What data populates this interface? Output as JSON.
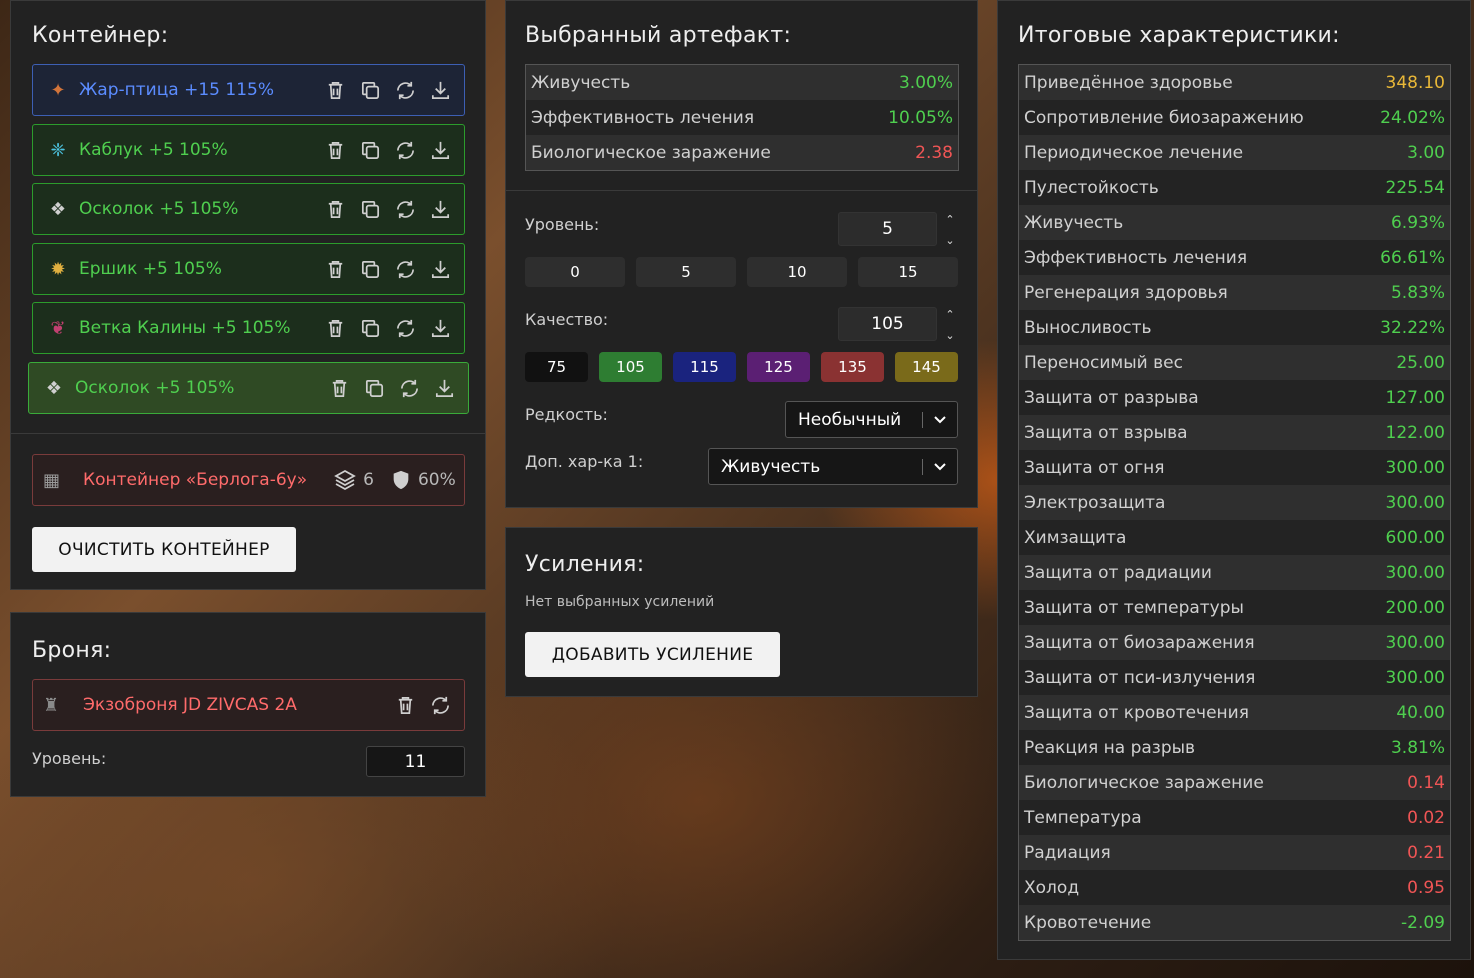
{
  "container": {
    "title": "Контейнер:",
    "items": [
      {
        "label": "Жар-птица +15 115%"
      },
      {
        "label": "Каблук +5 105%"
      },
      {
        "label": "Осколок +5 105%"
      },
      {
        "label": "Ершик +5 105%"
      },
      {
        "label": "Ветка Калины +5 105%"
      },
      {
        "label": "Осколок +5 105%"
      }
    ],
    "box": {
      "label": "Контейнер «Берлога-6у»",
      "slots": "6",
      "protection": "60%"
    },
    "clear_button": "ОЧИСТИТЬ КОНТЕЙНЕР"
  },
  "armor": {
    "title": "Броня:",
    "name": "Экзоброня JD ZIVCAS 2A",
    "level_label": "Уровень:",
    "level_value": "11"
  },
  "artifact": {
    "title": "Выбранный артефакт:",
    "stats": [
      {
        "name": "Живучесть",
        "value": "3.00%",
        "color": "green"
      },
      {
        "name": "Эффективность лечения",
        "value": "10.05%",
        "color": "green"
      },
      {
        "name": "Биологическое заражение",
        "value": "2.38",
        "color": "red"
      }
    ],
    "level_label": "Уровень:",
    "level_value": "5",
    "level_presets": [
      "0",
      "5",
      "10",
      "15"
    ],
    "quality_label": "Качество:",
    "quality_value": "105",
    "quality_presets": [
      {
        "label": "75",
        "color": "#111111"
      },
      {
        "label": "105",
        "color": "#2e7d32"
      },
      {
        "label": "115",
        "color": "#1a237e"
      },
      {
        "label": "125",
        "color": "#5b1f73"
      },
      {
        "label": "135",
        "color": "#8a3232"
      },
      {
        "label": "145",
        "color": "#7a6a1a"
      }
    ],
    "rarity_label": "Редкость:",
    "rarity_value": "Необычный",
    "extra_label": "Доп. хар-ка 1:",
    "extra_value": "Живучесть"
  },
  "upgrades": {
    "title": "Усиления:",
    "empty_note": "Нет выбранных усилений",
    "add_button": "ДОБАВИТЬ УСИЛЕНИЕ"
  },
  "totals": {
    "title": "Итоговые характеристики:",
    "stats": [
      {
        "name": "Приведённое здоровье",
        "value": "348.10",
        "color": "yellow"
      },
      {
        "name": "Сопротивление биозаражению",
        "value": "24.02%",
        "color": "green"
      },
      {
        "name": "Периодическое лечение",
        "value": "3.00",
        "color": "green"
      },
      {
        "name": "Пулестойкость",
        "value": "225.54",
        "color": "green"
      },
      {
        "name": "Живучесть",
        "value": "6.93%",
        "color": "green"
      },
      {
        "name": "Эффективность лечения",
        "value": "66.61%",
        "color": "green"
      },
      {
        "name": "Регенерация здоровья",
        "value": "5.83%",
        "color": "green"
      },
      {
        "name": "Выносливость",
        "value": "32.22%",
        "color": "green"
      },
      {
        "name": "Переносимый вес",
        "value": "25.00",
        "color": "green"
      },
      {
        "name": "Защита от разрыва",
        "value": "127.00",
        "color": "green"
      },
      {
        "name": "Защита от взрыва",
        "value": "122.00",
        "color": "green"
      },
      {
        "name": "Защита от огня",
        "value": "300.00",
        "color": "green"
      },
      {
        "name": "Электрозащита",
        "value": "300.00",
        "color": "green"
      },
      {
        "name": "Химзащита",
        "value": "600.00",
        "color": "green"
      },
      {
        "name": "Защита от радиации",
        "value": "300.00",
        "color": "green"
      },
      {
        "name": "Защита от температуры",
        "value": "200.00",
        "color": "green"
      },
      {
        "name": "Защита от биозаражения",
        "value": "300.00",
        "color": "green"
      },
      {
        "name": "Защита от пси-излучения",
        "value": "300.00",
        "color": "green"
      },
      {
        "name": "Защита от кровотечения",
        "value": "40.00",
        "color": "green"
      },
      {
        "name": "Реакция на разрыв",
        "value": "3.81%",
        "color": "green"
      },
      {
        "name": "Биологическое заражение",
        "value": "0.14",
        "color": "red"
      },
      {
        "name": "Температура",
        "value": "0.02",
        "color": "red"
      },
      {
        "name": "Радиация",
        "value": "0.21",
        "color": "red"
      },
      {
        "name": "Холод",
        "value": "0.95",
        "color": "red"
      },
      {
        "name": "Кровотечение",
        "value": "-2.09",
        "color": "green"
      }
    ]
  }
}
